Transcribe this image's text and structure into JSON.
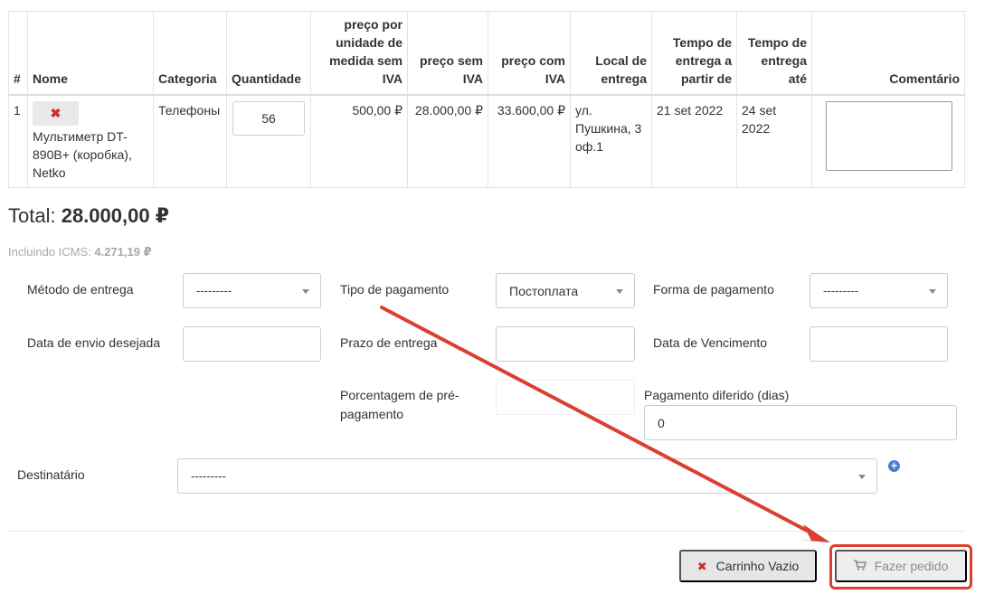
{
  "table": {
    "headers": {
      "num": "#",
      "name": "Nome",
      "category": "Categoria",
      "quantity": "Quantidade",
      "unit_price": "preço por unidade de medida sem IVA",
      "price_no_vat": "preço sem IVA",
      "price_with_vat": "preço com IVA",
      "location": "Local de entrega",
      "delivery_from": "Tempo de entrega a partir de",
      "delivery_to": "Tempo de entrega até",
      "comment": "Comentário"
    },
    "rows": [
      {
        "num": "1",
        "name": "Мультиметр DT-890B+ (коробка), Netko",
        "category": "Телефоны",
        "quantity": "56",
        "unit_price": "500,00 ₽",
        "price_no_vat": "28.000,00 ₽",
        "price_with_vat": "33.600,00 ₽",
        "location": "ул. Пушкина, 3 оф.1",
        "delivery_from": "21 set 2022",
        "delivery_to": "24 set 2022",
        "comment": ""
      }
    ]
  },
  "summary": {
    "total_label": "Total:",
    "total_value": "28.000,00 ₽",
    "icms_label": "Incluindo ICMS:",
    "icms_value": "4.271,19 ₽"
  },
  "form": {
    "delivery_method_label": "Método de entrega",
    "delivery_method_value": "---------",
    "payment_type_label": "Tipo de pagamento",
    "payment_type_value": "Постоплата",
    "payment_form_label": "Forma de pagamento",
    "payment_form_value": "---------",
    "desired_ship_date_label": "Data de envio desejada",
    "delivery_term_label": "Prazo de entrega",
    "due_date_label": "Data de Vencimento",
    "prepay_percent_label": "Porcentagem de pré-pagamento",
    "deferred_payment_label": "Pagamento diferido (dias)",
    "deferred_payment_value": "0",
    "recipient_label": "Destinatário",
    "recipient_value": "---------"
  },
  "actions": {
    "empty_cart_label": "Carrinho Vazio",
    "place_order_label": "Fazer pedido"
  },
  "colors": {
    "highlight": "#d9402f",
    "remove": "#c9302c",
    "add": "#4a7fd1"
  },
  "icons": {
    "remove": "close-icon",
    "add": "plus-circle-icon",
    "cart": "cart-icon"
  }
}
